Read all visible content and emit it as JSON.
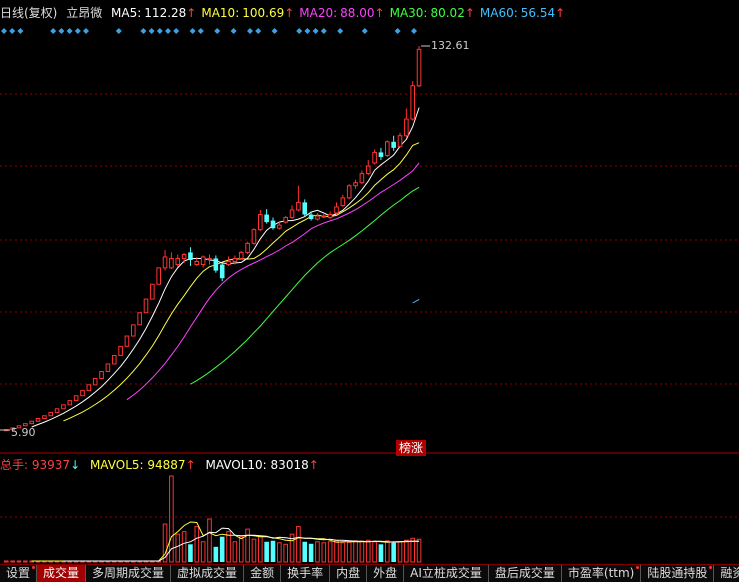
{
  "header": {
    "title": "日线(复权)",
    "stock_name": "立昂微",
    "ma": [
      {
        "label": "MA5:",
        "value": "112.28",
        "arrow": "↑",
        "color": "#ffffff"
      },
      {
        "label": "MA10:",
        "value": "100.69",
        "arrow": "↑",
        "color": "#ffff40"
      },
      {
        "label": "MA20:",
        "value": "88.00",
        "arrow": "↑",
        "color": "#ff40ff"
      },
      {
        "label": "MA30:",
        "value": "80.02",
        "arrow": "↑",
        "color": "#40ff40"
      },
      {
        "label": "MA60:",
        "value": "56.54",
        "arrow": "↑",
        "color": "#40c0ff"
      }
    ]
  },
  "price_labels": {
    "high": "132.61",
    "low": "5.90"
  },
  "badge": "榜涨",
  "volume_header": {
    "vol_label": "总手:",
    "vol_value": "93937",
    "vol_arrow": "↓",
    "mavol5_label": "MAVOL5:",
    "mavol5_value": "94887",
    "mavol5_arrow": "↑",
    "mavol10_label": "MAVOL10:",
    "mavol10_value": "83018",
    "mavol10_arrow": "↑"
  },
  "tabs": [
    {
      "label": "设置",
      "active": false,
      "dot": true
    },
    {
      "label": "成交量",
      "active": true,
      "dot": false
    },
    {
      "label": "多周期成交量",
      "active": false,
      "dot": false
    },
    {
      "label": "虚拟成交量",
      "active": false,
      "dot": false
    },
    {
      "label": "金额",
      "active": false,
      "dot": false
    },
    {
      "label": "换手率",
      "active": false,
      "dot": false
    },
    {
      "label": "内盘",
      "active": false,
      "dot": false
    },
    {
      "label": "外盘",
      "active": false,
      "dot": false
    },
    {
      "label": "AI立桩成交量",
      "active": false,
      "dot": false
    },
    {
      "label": "盘后成交量",
      "active": false,
      "dot": false
    },
    {
      "label": "市盈率(ttm)",
      "active": false,
      "dot": true
    },
    {
      "label": "陆股通持股",
      "active": false,
      "dot": true
    },
    {
      "label": "融资",
      "active": false,
      "dot": false
    }
  ],
  "colors": {
    "up": "#ff3232",
    "down": "#54ffff",
    "grid": "#8b0000",
    "diamond": "#3ea0e0"
  },
  "chart_data": {
    "type": "candlestick",
    "ylim": [
      5.9,
      132.61
    ],
    "candles": [
      [
        5.9,
        6.0,
        6.2,
        5.8
      ],
      [
        6.0,
        6.6,
        6.7,
        6.0
      ],
      [
        6.6,
        7.3,
        7.3,
        6.6
      ],
      [
        7.3,
        8.0,
        8.0,
        7.3
      ],
      [
        8.0,
        8.8,
        8.8,
        8.0
      ],
      [
        8.8,
        9.7,
        9.7,
        8.8
      ],
      [
        9.7,
        10.6,
        10.6,
        9.7
      ],
      [
        10.6,
        11.7,
        11.7,
        10.6
      ],
      [
        11.7,
        12.9,
        12.9,
        11.7
      ],
      [
        12.9,
        14.2,
        14.2,
        12.9
      ],
      [
        14.2,
        15.6,
        15.6,
        14.2
      ],
      [
        15.6,
        17.2,
        17.2,
        15.6
      ],
      [
        17.2,
        18.9,
        18.9,
        17.2
      ],
      [
        18.9,
        20.8,
        20.8,
        18.9
      ],
      [
        20.8,
        22.9,
        22.9,
        20.8
      ],
      [
        22.9,
        25.2,
        25.2,
        22.9
      ],
      [
        25.2,
        27.7,
        27.7,
        25.2
      ],
      [
        27.7,
        30.5,
        30.5,
        27.7
      ],
      [
        30.5,
        33.5,
        33.5,
        30.5
      ],
      [
        33.5,
        36.9,
        36.9,
        33.5
      ],
      [
        36.9,
        40.6,
        40.6,
        36.9
      ],
      [
        40.6,
        44.6,
        44.6,
        40.6
      ],
      [
        44.6,
        49.1,
        49.1,
        44.6
      ],
      [
        49.1,
        54.0,
        54.0,
        49.1
      ],
      [
        54.0,
        59.4,
        59.4,
        54.0
      ],
      [
        59.4,
        63.0,
        65.3,
        58.5
      ],
      [
        59.4,
        62.5,
        64.5,
        59.0
      ],
      [
        60.5,
        62.5,
        63.8,
        59.8
      ],
      [
        62.5,
        63.8,
        64.3,
        61.0
      ],
      [
        64.5,
        62.0,
        66.2,
        60.0
      ],
      [
        60.5,
        61.5,
        63.0,
        60.0
      ],
      [
        60.5,
        63.0,
        63.5,
        59.5
      ],
      [
        62.5,
        62.5,
        63.8,
        60.5
      ],
      [
        62.5,
        58.5,
        63.5,
        57.8
      ],
      [
        60.5,
        56.0,
        61.0,
        55.0
      ],
      [
        60.5,
        61.5,
        63.2,
        60.0
      ],
      [
        61.5,
        62.5,
        63.5,
        60.5
      ],
      [
        62.5,
        64.5,
        65.0,
        62.0
      ],
      [
        64.5,
        67.5,
        68.0,
        64.0
      ],
      [
        67.5,
        72.0,
        72.5,
        67.0
      ],
      [
        72.0,
        77.0,
        78.5,
        71.5
      ],
      [
        77.0,
        74.5,
        78.8,
        74.0
      ],
      [
        75.0,
        72.5,
        76.0,
        72.0
      ],
      [
        72.5,
        73.5,
        74.5,
        72.0
      ],
      [
        74.5,
        76.0,
        76.5,
        74.0
      ],
      [
        76.0,
        78.5,
        80.0,
        75.5
      ],
      [
        78.5,
        81.0,
        86.5,
        78.0
      ],
      [
        81.0,
        77.0,
        82.0,
        76.5
      ],
      [
        77.0,
        75.5,
        78.0,
        75.0
      ],
      [
        75.5,
        76.5,
        77.5,
        75.0
      ],
      [
        76.5,
        76.5,
        77.5,
        75.8
      ],
      [
        76.0,
        77.0,
        78.0,
        75.5
      ],
      [
        77.5,
        79.5,
        81.0,
        77.0
      ],
      [
        80.0,
        82.5,
        83.5,
        79.5
      ],
      [
        82.5,
        86.5,
        87.0,
        82.0
      ],
      [
        86.5,
        87.5,
        88.5,
        85.5
      ],
      [
        87.5,
        90.5,
        91.5,
        87.0
      ],
      [
        90.5,
        93.0,
        95.0,
        90.0
      ],
      [
        94.0,
        97.5,
        98.5,
        93.5
      ],
      [
        97.5,
        96.0,
        99.0,
        95.0
      ],
      [
        96.5,
        101.0,
        101.5,
        96.0
      ],
      [
        101.0,
        99.0,
        103.0,
        98.0
      ],
      [
        99.5,
        103.0,
        104.0,
        99.0
      ],
      [
        103.0,
        108.5,
        112.0,
        102.5
      ],
      [
        108.5,
        119.5,
        121.0,
        108.0
      ],
      [
        119.5,
        131.5,
        132.61,
        119.0
      ]
    ],
    "ma5": [
      null,
      null,
      null,
      null,
      6.9,
      7.7,
      8.5,
      9.4,
      10.4,
      11.4,
      12.6,
      13.8,
      15.2,
      16.7,
      18.4,
      20.2,
      22.3,
      24.5,
      26.9,
      29.6,
      32.6,
      35.8,
      39.4,
      43.4,
      47.7,
      52.5,
      56.5,
      59.5,
      61.6,
      62.5,
      62.5,
      62.5,
      62.0,
      61.8,
      61.0,
      60.8,
      61.0,
      61.2,
      62.6,
      65.5,
      69.0,
      71.8,
      73.4,
      74.5,
      75.0,
      75.0,
      75.5,
      76.3,
      77.8,
      78.4,
      77.5,
      76.5,
      77.2,
      78.4,
      80.4,
      82.6,
      85.2,
      88.0,
      91.6,
      93.4,
      95.0,
      96.6,
      99.5,
      101.8,
      106.0,
      112.28
    ],
    "ma10": [
      null,
      null,
      null,
      null,
      null,
      null,
      null,
      null,
      null,
      8.9,
      9.8,
      10.8,
      11.8,
      13.0,
      14.3,
      15.7,
      17.3,
      19.0,
      20.9,
      23.0,
      25.3,
      27.8,
      30.6,
      33.6,
      37.0,
      40.7,
      44.2,
      47.4,
      50.2,
      53.2,
      56.0,
      58.3,
      59.8,
      60.4,
      61.3,
      62.0,
      62.3,
      62.4,
      62.3,
      62.5,
      63.8,
      65.6,
      67.6,
      69.5,
      71.5,
      72.8,
      74.1,
      75.2,
      76.4,
      76.8,
      76.4,
      76.3,
      76.7,
      77.9,
      79.2,
      80.6,
      82.2,
      84.2,
      86.6,
      88.5,
      90.3,
      91.8,
      93.9,
      96.6,
      99.8,
      100.69
    ],
    "ma20": [
      null,
      null,
      null,
      null,
      null,
      null,
      null,
      null,
      null,
      null,
      null,
      null,
      null,
      null,
      null,
      null,
      null,
      null,
      null,
      15.9,
      17.4,
      19.1,
      21.0,
      23.1,
      25.4,
      27.9,
      30.6,
      33.5,
      36.6,
      39.9,
      43.1,
      46.4,
      49.4,
      52.0,
      54.2,
      56.1,
      57.6,
      58.9,
      60.0,
      61.0,
      62.0,
      63.1,
      64.1,
      65.3,
      66.6,
      67.8,
      69.2,
      70.7,
      72.3,
      73.3,
      74.2,
      74.9,
      75.6,
      76.5,
      77.5,
      78.6,
      79.9,
      81.3,
      82.8,
      84.3,
      85.6,
      86.9,
      88.3,
      89.8,
      91.4,
      94.0
    ],
    "ma30": [
      null,
      null,
      null,
      null,
      null,
      null,
      null,
      null,
      null,
      null,
      null,
      null,
      null,
      null,
      null,
      null,
      null,
      null,
      null,
      null,
      null,
      null,
      null,
      null,
      null,
      null,
      null,
      null,
      null,
      21.0,
      22.2,
      23.6,
      25.0,
      26.6,
      28.2,
      30.0,
      31.8,
      33.8,
      35.8,
      38.0,
      40.2,
      42.6,
      45.0,
      47.4,
      49.8,
      52.2,
      54.6,
      56.9,
      59.0,
      61.0,
      62.8,
      64.4,
      65.8,
      67.1,
      68.5,
      70.0,
      71.6,
      73.3,
      75.0,
      76.8,
      78.5,
      80.1,
      81.6,
      83.2,
      84.8,
      86.0
    ],
    "ma60": [
      null,
      null,
      null,
      null,
      null,
      null,
      null,
      null,
      null,
      null,
      null,
      null,
      null,
      null,
      null,
      null,
      null,
      null,
      null,
      null,
      null,
      null,
      null,
      null,
      null,
      null,
      null,
      null,
      null,
      null,
      null,
      null,
      null,
      null,
      null,
      null,
      null,
      null,
      null,
      null,
      null,
      null,
      null,
      null,
      null,
      null,
      null,
      null,
      null,
      null,
      null,
      null,
      null,
      null,
      null,
      null,
      null,
      null,
      null,
      null,
      null,
      null,
      null,
      null,
      47.8,
      49.0
    ],
    "volume": [
      200,
      200,
      200,
      200,
      200,
      200,
      200,
      200,
      200,
      200,
      200,
      200,
      200,
      200,
      200,
      200,
      200,
      200,
      200,
      200,
      200,
      200,
      200,
      200,
      200,
      7500,
      17000,
      5500,
      6000,
      3500,
      7000,
      4000,
      8500,
      3000,
      5000,
      6000,
      4000,
      5000,
      6500,
      4500,
      5000,
      4000,
      4200,
      3800,
      3500,
      5500,
      7000,
      4000,
      3600,
      4000,
      3800,
      4000,
      4200,
      3800,
      3900,
      4200,
      4100,
      4300,
      4000,
      3500,
      4200,
      3800,
      4000,
      4300,
      4700,
      4500
    ],
    "mavol5": [
      null,
      null,
      null,
      null,
      200,
      200,
      200,
      200,
      200,
      200,
      200,
      200,
      200,
      200,
      200,
      200,
      200,
      200,
      200,
      200,
      200,
      200,
      200,
      200,
      200,
      1600,
      5000,
      6000,
      7200,
      7900,
      7800,
      5200,
      5800,
      5200,
      5500,
      5300,
      5300,
      4600,
      5300,
      5200,
      5000,
      5000,
      4800,
      4600,
      4300,
      4200,
      4800,
      4700,
      4700,
      4600,
      4600,
      4300,
      3900,
      4000,
      4000,
      4000,
      4000,
      4000,
      4100,
      4000,
      3900,
      4000,
      4000,
      4000,
      4100,
      4100
    ],
    "mavol10": [
      null,
      null,
      null,
      null,
      null,
      null,
      null,
      null,
      null,
      200,
      200,
      200,
      200,
      200,
      200,
      200,
      200,
      200,
      200,
      200,
      200,
      200,
      200,
      200,
      200,
      900,
      2600,
      3100,
      3700,
      4000,
      4700,
      5100,
      5900,
      5800,
      6700,
      6600,
      5300,
      5200,
      5300,
      5300,
      5200,
      5100,
      4700,
      4900,
      4800,
      4600,
      4900,
      4700,
      4700,
      4500,
      4400,
      4500,
      4300,
      4300,
      4200,
      4100,
      4100,
      4000,
      4100,
      4100,
      4000,
      3900,
      4000,
      4100,
      4100,
      4100
    ]
  }
}
